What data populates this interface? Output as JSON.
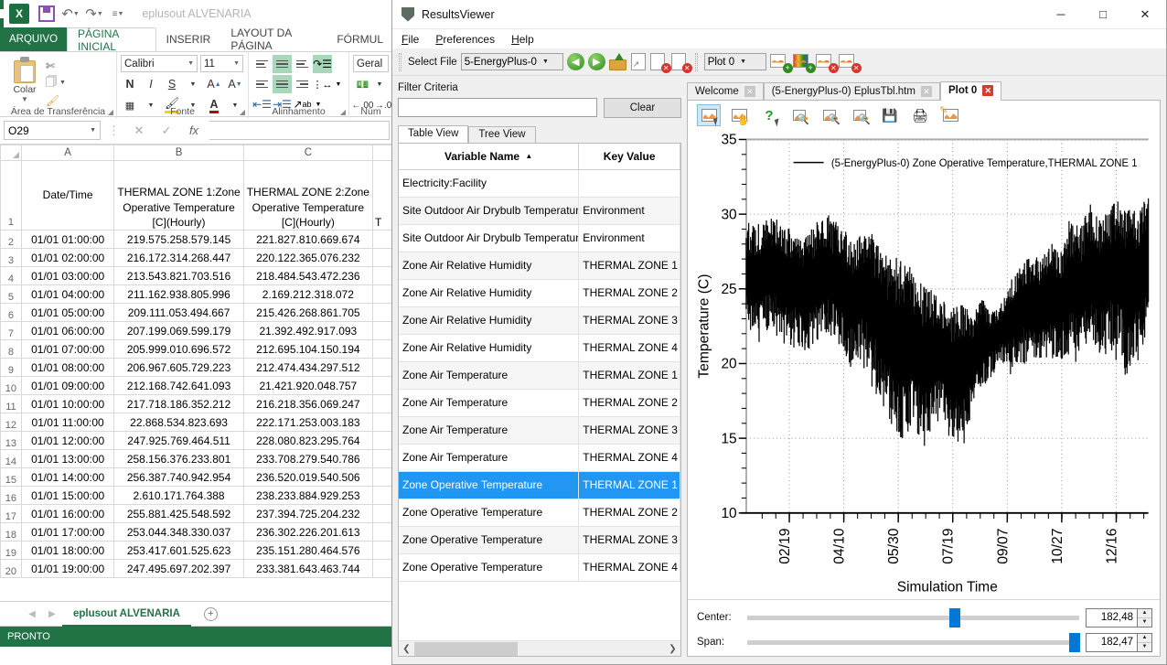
{
  "excel": {
    "document_title": "eplusout ALVENARIA",
    "quick_access": [
      "save-icon",
      "undo-icon",
      "redo-icon",
      "customize-icon"
    ],
    "ribbon_tabs": [
      {
        "label": "ARQUIVO",
        "active": false,
        "file": true
      },
      {
        "label": "PÁGINA INICIAL",
        "active": true
      },
      {
        "label": "INSERIR",
        "active": false
      },
      {
        "label": "LAYOUT DA PÁGINA",
        "active": false
      },
      {
        "label": "FÓRMUL",
        "active": false
      }
    ],
    "ribbon_groups": [
      {
        "label": "Área de Transferência",
        "paste_label": "Colar"
      },
      {
        "label": "Fonte",
        "font_name": "Calibri",
        "font_size": "11",
        "buttons": [
          "N",
          "I",
          "S"
        ]
      },
      {
        "label": "Alinhamento"
      },
      {
        "label": "Núm",
        "format": "Geral"
      }
    ],
    "name_box": "O29",
    "formula_bar_value": "",
    "formula_icons": [
      "cancel-icon",
      "confirm-icon",
      "function-icon"
    ],
    "columns": [
      "A",
      "B",
      "C"
    ],
    "header_row": {
      "row_number": "1",
      "a": "Date/Time",
      "b": "THERMAL ZONE 1:Zone Operative Temperature [C](Hourly)",
      "c": "THERMAL ZONE 2:Zone Operative Temperature [C](Hourly)",
      "d_partial": "T"
    },
    "rows": [
      {
        "n": "2",
        "a": "01/01  01:00:00",
        "b": "219.575.258.579.145",
        "c": "221.827.810.669.674"
      },
      {
        "n": "3",
        "a": "01/01  02:00:00",
        "b": "216.172.314.268.447",
        "c": "220.122.365.076.232"
      },
      {
        "n": "4",
        "a": "01/01  03:00:00",
        "b": "213.543.821.703.516",
        "c": "218.484.543.472.236"
      },
      {
        "n": "5",
        "a": "01/01  04:00:00",
        "b": "211.162.938.805.996",
        "c": "2.169.212.318.072"
      },
      {
        "n": "6",
        "a": "01/01  05:00:00",
        "b": "209.111.053.494.667",
        "c": "215.426.268.861.705"
      },
      {
        "n": "7",
        "a": "01/01  06:00:00",
        "b": "207.199.069.599.179",
        "c": "21.392.492.917.093"
      },
      {
        "n": "8",
        "a": "01/01  07:00:00",
        "b": "205.999.010.696.572",
        "c": "212.695.104.150.194"
      },
      {
        "n": "9",
        "a": "01/01  08:00:00",
        "b": "206.967.605.729.223",
        "c": "212.474.434.297.512"
      },
      {
        "n": "10",
        "a": "01/01  09:00:00",
        "b": "212.168.742.641.093",
        "c": "21.421.920.048.757"
      },
      {
        "n": "11",
        "a": "01/01  10:00:00",
        "b": "217.718.186.352.212",
        "c": "216.218.356.069.247"
      },
      {
        "n": "12",
        "a": "01/01  11:00:00",
        "b": "22.868.534.823.693",
        "c": "222.171.253.003.183"
      },
      {
        "n": "13",
        "a": "01/01  12:00:00",
        "b": "247.925.769.464.511",
        "c": "228.080.823.295.764"
      },
      {
        "n": "14",
        "a": "01/01  13:00:00",
        "b": "258.156.376.233.801",
        "c": "233.708.279.540.786"
      },
      {
        "n": "15",
        "a": "01/01  14:00:00",
        "b": "256.387.740.942.954",
        "c": "236.520.019.540.506"
      },
      {
        "n": "16",
        "a": "01/01  15:00:00",
        "b": "2.610.171.764.388",
        "c": "238.233.884.929.253"
      },
      {
        "n": "17",
        "a": "01/01  16:00:00",
        "b": "255.881.425.548.592",
        "c": "237.394.725.204.232"
      },
      {
        "n": "18",
        "a": "01/01  17:00:00",
        "b": "253.044.348.330.037",
        "c": "236.302.226.201.613"
      },
      {
        "n": "19",
        "a": "01/01  18:00:00",
        "b": "253.417.601.525.623",
        "c": "235.151.280.464.576"
      },
      {
        "n": "20",
        "a": "01/01  19:00:00",
        "b": "247.495.697.202.397",
        "c": "233.381.643.463.744"
      }
    ],
    "sheet_tab": "eplusout ALVENARIA",
    "add_sheet_label": "+",
    "status": "PRONTO",
    "accent_color": "#217346"
  },
  "resultsviewer": {
    "title": "ResultsViewer",
    "window_buttons": {
      "minimize": "─",
      "maximize": "□",
      "close": "✕"
    },
    "menu": [
      "File",
      "Preferences",
      "Help"
    ],
    "toolbar": {
      "select_file_label": "Select File",
      "select_file_value": "5-EnergyPlus-0",
      "icons": [
        "previous-file-icon",
        "next-file-icon",
        "open-file-icon",
        "report-icon",
        "close-file-icon",
        "close-all-files-icon"
      ],
      "plot_select_value": "Plot 0",
      "plot_icons": [
        "new-plot-icon",
        "new-color-plot-icon",
        "close-plot-icon",
        "close-all-plots-icon"
      ]
    },
    "filter": {
      "label": "Filter Criteria",
      "value": "",
      "placeholder": "",
      "clear_label": "Clear"
    },
    "view_tabs": [
      {
        "label": "Table View",
        "active": true
      },
      {
        "label": "Tree View",
        "active": false
      }
    ],
    "variable_table": {
      "columns": [
        "Variable Name",
        "Key Value"
      ],
      "sort_indicator": "▲",
      "rows": [
        {
          "name": "Electricity:Facility",
          "key": "",
          "selected": false
        },
        {
          "name": "Site Outdoor Air Drybulb Temperature",
          "key": "Environment",
          "selected": false
        },
        {
          "name": "Site Outdoor Air Drybulb Temperature",
          "key": "Environment",
          "selected": false
        },
        {
          "name": "Zone Air Relative Humidity",
          "key": "THERMAL ZONE 1",
          "selected": false
        },
        {
          "name": "Zone Air Relative Humidity",
          "key": "THERMAL ZONE 2",
          "selected": false
        },
        {
          "name": "Zone Air Relative Humidity",
          "key": "THERMAL ZONE 3",
          "selected": false
        },
        {
          "name": "Zone Air Relative Humidity",
          "key": "THERMAL ZONE 4",
          "selected": false
        },
        {
          "name": "Zone Air Temperature",
          "key": "THERMAL ZONE 1",
          "selected": false
        },
        {
          "name": "Zone Air Temperature",
          "key": "THERMAL ZONE 2",
          "selected": false
        },
        {
          "name": "Zone Air Temperature",
          "key": "THERMAL ZONE 3",
          "selected": false
        },
        {
          "name": "Zone Air Temperature",
          "key": "THERMAL ZONE 4",
          "selected": false
        },
        {
          "name": "Zone Operative Temperature",
          "key": "THERMAL ZONE 1",
          "selected": true
        },
        {
          "name": "Zone Operative Temperature",
          "key": "THERMAL ZONE 2",
          "selected": false
        },
        {
          "name": "Zone Operative Temperature",
          "key": "THERMAL ZONE 3",
          "selected": false
        },
        {
          "name": "Zone Operative Temperature",
          "key": "THERMAL ZONE 4",
          "selected": false
        }
      ]
    },
    "plot_tabs": [
      {
        "label": "Welcome",
        "active": false,
        "close_red": false
      },
      {
        "label": "(5-EnergyPlus-0) EplusTbl.htm",
        "active": false,
        "close_red": false
      },
      {
        "label": "Plot 0",
        "active": true,
        "close_red": true
      }
    ],
    "plot_toolbar_icons": [
      "select-tool-icon",
      "pan-tool-icon",
      "help-tool-icon",
      "zoom-box-icon",
      "zoom-in-icon",
      "zoom-out-icon",
      "save-plot-icon",
      "print-plot-icon",
      "edit-plot-icon"
    ],
    "sliders": [
      {
        "label": "Center:",
        "value": "182,48",
        "position_pct": 61
      },
      {
        "label": "Span:",
        "value": "182,47",
        "position_pct": 97
      }
    ],
    "accent_color": "#0078d7",
    "selection_color": "#2196f3"
  },
  "chart_data": {
    "type": "line",
    "title": "",
    "xlabel": "Simulation Time",
    "ylabel": "Temperature (C)",
    "ylim": [
      10,
      35
    ],
    "yticks": [
      10,
      15,
      20,
      25,
      30,
      35
    ],
    "xtick_labels": [
      "02/19",
      "04/10",
      "05/30",
      "07/19",
      "09/07",
      "10/27",
      "12/16"
    ],
    "grid": true,
    "legend_position": "top-center-inside",
    "legend": [
      {
        "name": "(5-EnergyPlus-0) Zone Operative Temperature,THERMAL ZONE 1",
        "color": "#000000"
      }
    ],
    "series": [
      {
        "name": "(5-EnergyPlus-0) Zone Operative Temperature,THERMAL ZONE 1",
        "color": "#000000",
        "description": "Hourly zone operative temperature over one simulation year; dense oscillating band",
        "envelope_max": [
          29.4,
          29.1,
          29.6,
          29.8,
          29.2,
          28.9,
          28.4,
          29.1,
          29.9,
          29.5,
          28.8,
          28.2,
          29.1,
          28.6,
          27.4,
          26.8,
          27.1,
          26.2,
          25.4,
          24.9,
          24.4,
          23.8,
          24.6,
          23.1,
          24.6,
          23.4,
          24.2,
          25.6,
          26.5,
          27.3,
          27.1,
          28.0,
          27.5,
          29.5,
          28.9,
          30.7,
          29.6,
          30.2,
          31.3,
          30.5,
          30.1,
          31.4
        ],
        "envelope_min": [
          22.2,
          21.9,
          22.1,
          22.4,
          21.6,
          21.4,
          20.8,
          21.2,
          21.9,
          21.4,
          20.6,
          19.8,
          20.2,
          18.9,
          17.1,
          15.8,
          14.7,
          16.2,
          14.1,
          15.8,
          16.4,
          15.1,
          14.0,
          17.2,
          18.1,
          19.4,
          20.1,
          19.6,
          20.4,
          20.2,
          19.8,
          20.6,
          20.1,
          20.9,
          20.4,
          21.1,
          20.6,
          21.2,
          20.8,
          19.6,
          20.9,
          21.4
        ]
      }
    ]
  }
}
